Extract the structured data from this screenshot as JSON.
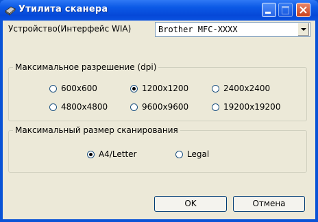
{
  "window": {
    "title": "Утилита сканера"
  },
  "device": {
    "label": "Устройство(Интерфейс WIA)",
    "value": "Brother MFC-XXXX"
  },
  "resolution": {
    "title": "Максимальное разрешение (dpi)",
    "options": [
      {
        "label": "600x600",
        "checked": false
      },
      {
        "label": "1200x1200",
        "checked": true
      },
      {
        "label": "2400x2400",
        "checked": false
      },
      {
        "label": "4800x4800",
        "checked": false
      },
      {
        "label": "9600x9600",
        "checked": false
      },
      {
        "label": "19200x19200",
        "checked": false
      }
    ]
  },
  "scan_size": {
    "title": "Максимальный размер сканирования",
    "options": [
      {
        "label": "A4/Letter",
        "checked": true
      },
      {
        "label": "Legal",
        "checked": false
      }
    ]
  },
  "buttons": {
    "ok": "OK",
    "cancel": "Отмена"
  },
  "colors": {
    "titlebar": "#0a52df",
    "client_bg": "#ece9d8",
    "close_button": "#c8411d"
  }
}
